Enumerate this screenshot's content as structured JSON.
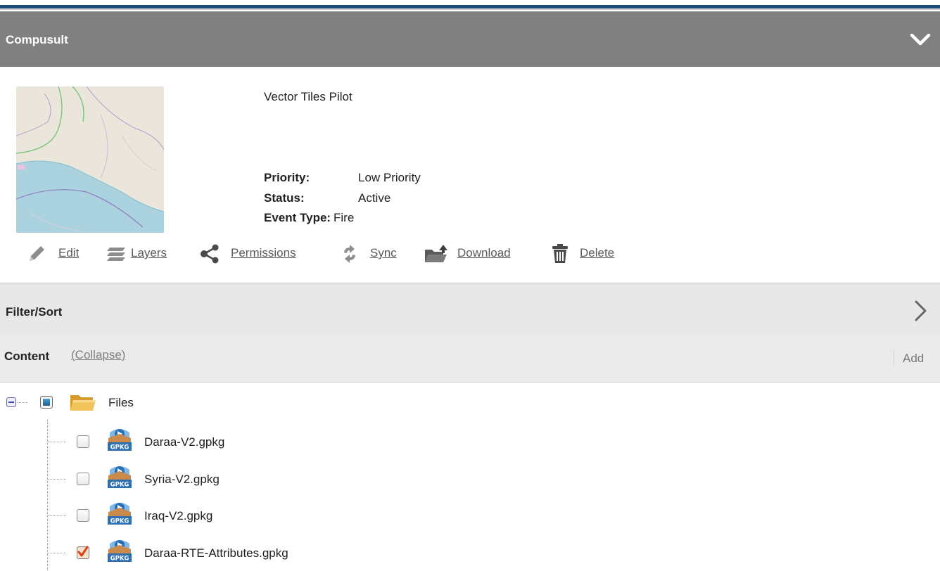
{
  "header": {
    "title": "Compusult",
    "chevron_icon": "chevron-down-icon"
  },
  "project": {
    "name": "Vector Tiles Pilot",
    "details": [
      {
        "key": "Priority:",
        "value": "Low Priority"
      },
      {
        "key": "Status:",
        "value": "Active"
      },
      {
        "key": "Event Type:",
        "value": "Fire"
      }
    ]
  },
  "actions": [
    {
      "icon": "pencil-icon",
      "label": "Edit"
    },
    {
      "icon": "layers-icon",
      "label": "Layers"
    },
    {
      "icon": "share-icon",
      "label": "Permissions"
    },
    {
      "icon": "sync-icon",
      "label": "Sync"
    },
    {
      "icon": "folder-upload-icon",
      "label": "Download"
    },
    {
      "icon": "trash-icon",
      "label": "Delete"
    }
  ],
  "filter": {
    "label": "Filter/Sort",
    "chevron_icon": "chevron-right-icon"
  },
  "content": {
    "label": "Content",
    "collapse_link": "(Collapse)",
    "add_label": "Add"
  },
  "tree": {
    "root": {
      "label": "Files",
      "checkbox": "partial",
      "icon": "folder-icon",
      "expanded": true
    },
    "files": [
      {
        "label": "Daraa-V2.gpkg",
        "checked": false,
        "icon": "gpkg-icon"
      },
      {
        "label": "Syria-V2.gpkg",
        "checked": false,
        "icon": "gpkg-icon"
      },
      {
        "label": "Iraq-V2.gpkg",
        "checked": false,
        "icon": "gpkg-icon"
      },
      {
        "label": "Daraa-RTE-Attributes.gpkg",
        "checked": true,
        "icon": "gpkg-icon"
      }
    ]
  },
  "colors": {
    "accent_bar": "#1e4a78",
    "header_bg": "#808080",
    "check_mark": "#d9420e"
  }
}
